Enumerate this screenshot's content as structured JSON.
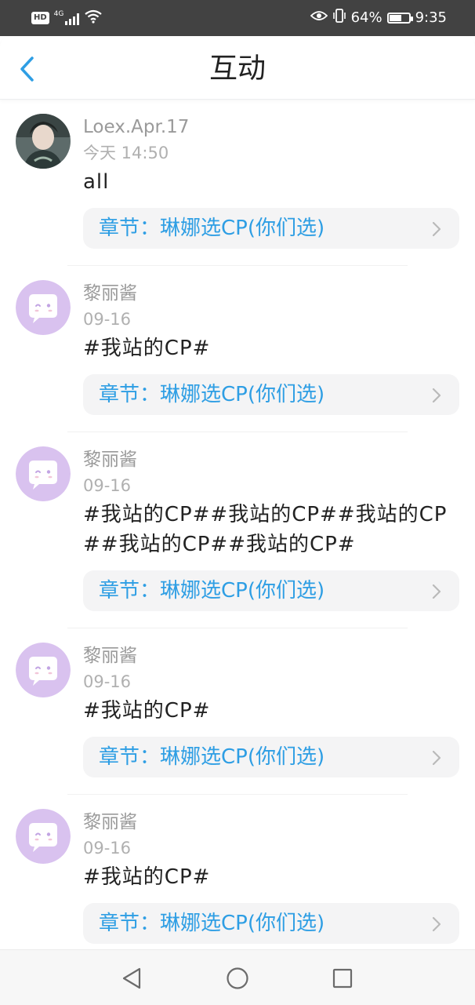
{
  "status_bar": {
    "network_label": "4G",
    "battery_text": "64%",
    "battery_level": 0.64,
    "time": "9:35",
    "icons": [
      "hd-icon",
      "signal-icon",
      "wifi-icon",
      "eye-icon",
      "vibrate-icon",
      "battery-icon"
    ]
  },
  "header": {
    "title": "互动",
    "back_icon": "chevron-left-icon"
  },
  "accent_color": "#2e9ee4",
  "feed": [
    {
      "username": "Loex.Apr.17",
      "time": "今天 14:50",
      "content": "all",
      "avatar": "photo",
      "chapter_prefix": "章节：",
      "chapter_title": "琳娜选CP(你们选)"
    },
    {
      "username": "黎丽酱",
      "time": "09-16",
      "content": "#我站的CP#",
      "avatar": "default",
      "chapter_prefix": "章节：",
      "chapter_title": "琳娜选CP(你们选)"
    },
    {
      "username": "黎丽酱",
      "time": "09-16",
      "content": "#我站的CP##我站的CP##我站的CP##我站的CP##我站的CP#",
      "avatar": "default",
      "chapter_prefix": "章节：",
      "chapter_title": "琳娜选CP(你们选)"
    },
    {
      "username": "黎丽酱",
      "time": "09-16",
      "content": "#我站的CP#",
      "avatar": "default",
      "chapter_prefix": "章节：",
      "chapter_title": "琳娜选CP(你们选)"
    },
    {
      "username": "黎丽酱",
      "time": "09-16",
      "content": "#我站的CP#",
      "avatar": "default",
      "chapter_prefix": "章节：",
      "chapter_title": "琳娜选CP(你们选)"
    }
  ],
  "nav_bar": {
    "buttons": [
      "back-triangle-icon",
      "home-circle-icon",
      "recents-square-icon"
    ]
  }
}
